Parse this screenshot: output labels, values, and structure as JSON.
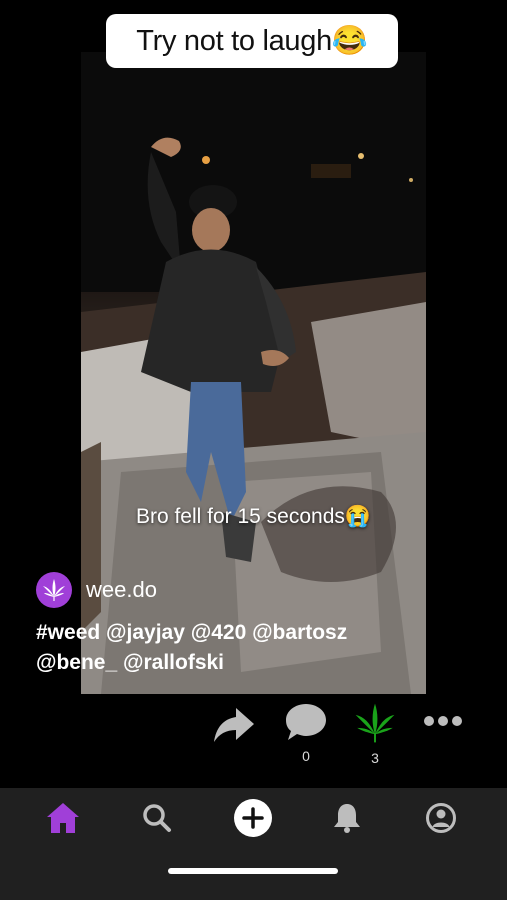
{
  "video": {
    "title": "Try not to laugh😂",
    "caption": "Bro fell for 15 seconds😭"
  },
  "post": {
    "author": "wee.do",
    "hashtags_line1": "#weed @jayjay @420 @bartosz",
    "hashtags_line2": "@bene_ @rallofski"
  },
  "actions": {
    "comments_count": "0",
    "likes_count": "3"
  },
  "icons": {
    "share": "share-arrow-icon",
    "comment": "speech-bubble-icon",
    "like": "cannabis-leaf-icon",
    "more": "more-dots-icon",
    "home": "home-icon",
    "search": "search-icon",
    "create": "plus-circle-icon",
    "notifications": "bell-icon",
    "profile": "profile-icon"
  },
  "colors": {
    "accent_purple": "#a03fd8",
    "leaf_green": "#1aa31a",
    "tabbar_bg": "#202020",
    "icon_gray": "#bdbdbd"
  }
}
